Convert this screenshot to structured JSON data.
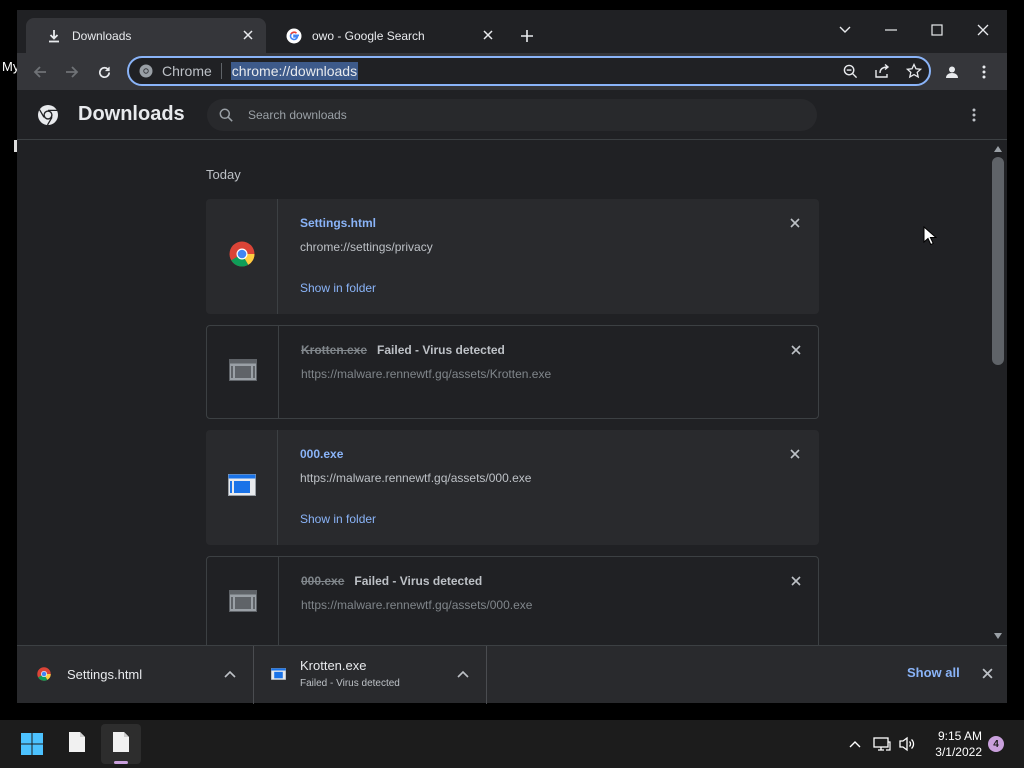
{
  "desktop": {
    "label": "My"
  },
  "tabs": [
    {
      "title": "Downloads",
      "icon": "download-icon"
    },
    {
      "title": "owo - Google Search",
      "icon": "google-icon"
    }
  ],
  "omnibox": {
    "chip": "Chrome",
    "url": "chrome://downloads"
  },
  "page": {
    "title": "Downloads",
    "search_placeholder": "Search downloads",
    "day_label": "Today"
  },
  "downloads": [
    {
      "name": "Settings.html",
      "status": "",
      "url": "chrome://settings/privacy",
      "action": "Show in folder",
      "failed": false
    },
    {
      "name": "Krotten.exe",
      "status": "Failed - Virus detected",
      "url": "https://malware.rennewtf.gq/assets/Krotten.exe",
      "action": "",
      "failed": true
    },
    {
      "name": "000.exe",
      "status": "",
      "url": "https://malware.rennewtf.gq/assets/000.exe",
      "action": "Show in folder",
      "failed": false
    },
    {
      "name": "000.exe",
      "status": "Failed - Virus detected",
      "url": "https://malware.rennewtf.gq/assets/000.exe",
      "action": "",
      "failed": true
    }
  ],
  "shelf": {
    "items": [
      {
        "name": "Settings.html",
        "status": ""
      },
      {
        "name": "Krotten.exe",
        "status": "Failed - Virus detected"
      }
    ],
    "show_all": "Show all"
  },
  "taskbar": {
    "time": "9:15 AM",
    "date": "3/1/2022",
    "notification_count": "4"
  },
  "colors": {
    "accent": "#8ab4f8",
    "tab_active": "#35363a",
    "background": "#202124"
  }
}
